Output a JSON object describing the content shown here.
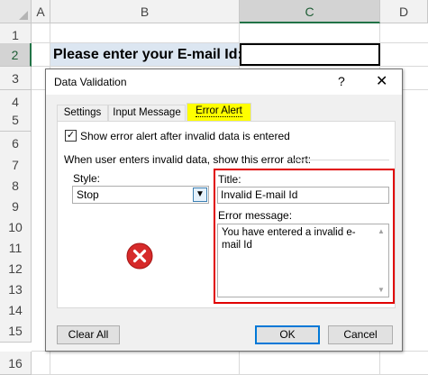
{
  "spreadsheet": {
    "columns": [
      {
        "label": "A",
        "selected": false
      },
      {
        "label": "B",
        "selected": false
      },
      {
        "label": "C",
        "selected": true
      },
      {
        "label": "D",
        "selected": false
      }
    ],
    "rows": [
      {
        "label": "1",
        "selected": false
      },
      {
        "label": "2",
        "selected": true
      },
      {
        "label": "3",
        "selected": false
      },
      {
        "label": "4",
        "selected": false
      },
      {
        "label": "5",
        "selected": false
      },
      {
        "label": "6",
        "selected": false
      },
      {
        "label": "7",
        "selected": false
      },
      {
        "label": "8",
        "selected": false
      },
      {
        "label": "9",
        "selected": false
      },
      {
        "label": "10",
        "selected": false
      },
      {
        "label": "11",
        "selected": false
      },
      {
        "label": "12",
        "selected": false
      },
      {
        "label": "13",
        "selected": false
      },
      {
        "label": "14",
        "selected": false
      },
      {
        "label": "15",
        "selected": false
      },
      {
        "label": "16",
        "selected": false
      }
    ],
    "prompt_cell": "Please enter your E-mail Id:",
    "input_cell": ""
  },
  "dialog": {
    "title": "Data Validation",
    "help": "?",
    "close": "✕",
    "tabs": [
      {
        "label": "Settings",
        "active": false
      },
      {
        "label": "Input Message",
        "active": false
      },
      {
        "label": "Error Alert",
        "active": true
      }
    ],
    "show_alert": {
      "checked": true,
      "label": "Show error alert after invalid data is entered"
    },
    "group_label": "When user enters invalid data, show this error alert:",
    "style_label": "Style:",
    "style_value": "Stop",
    "title_label": "Title:",
    "title_value": "Invalid E-mail Id",
    "message_label": "Error message:",
    "message_value": "You have entered a invalid e-mail Id",
    "buttons": {
      "clear_all": "Clear All",
      "ok": "OK",
      "cancel": "Cancel"
    }
  },
  "icons": {
    "error": "error-stop-icon",
    "checkmark": "checkmark-icon",
    "dropdown": "chevron-down-icon"
  },
  "colors": {
    "highlight_tab": "#ffff00",
    "highlight_box": "#e00000",
    "error_icon": "#d62a2a",
    "prompt_fill": "#dce6f1"
  }
}
